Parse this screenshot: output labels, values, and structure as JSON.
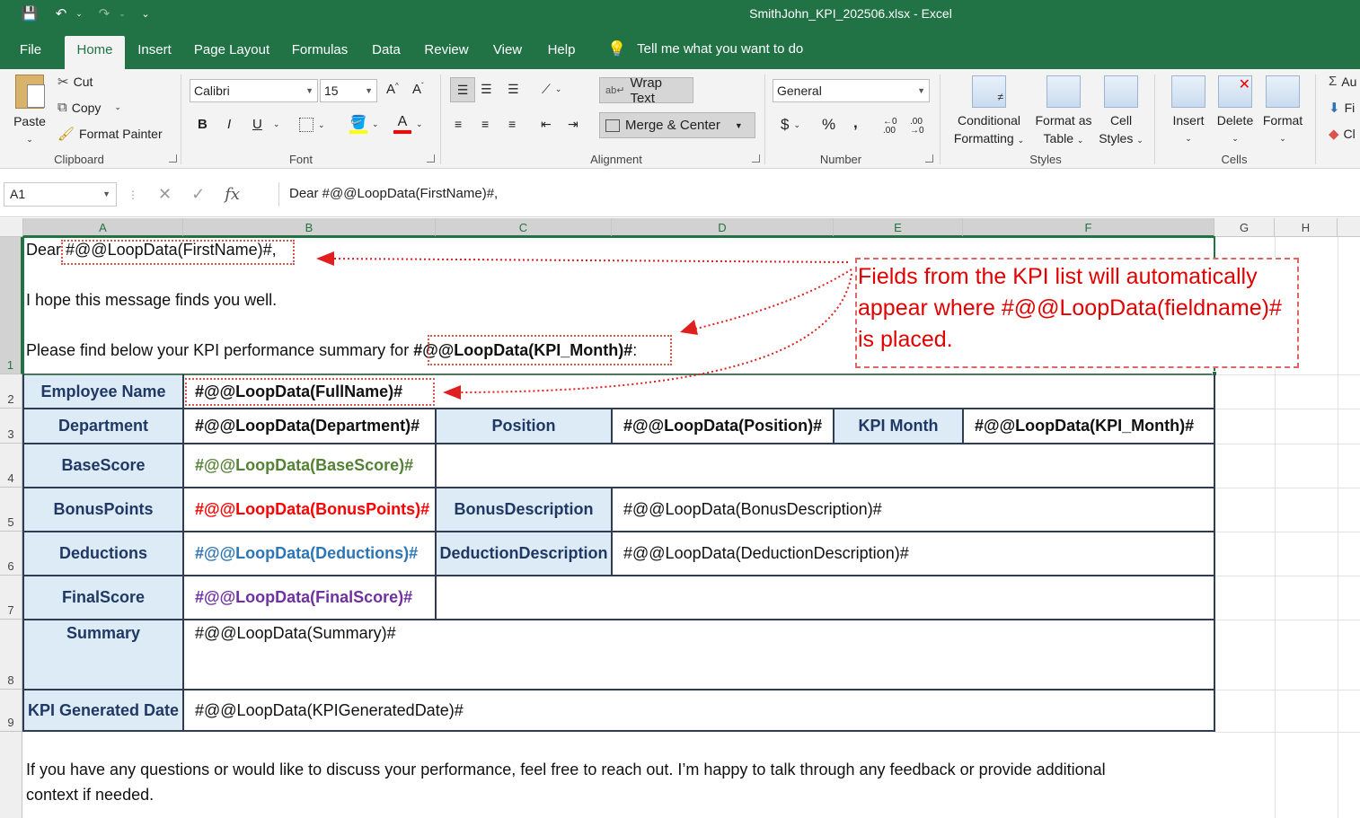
{
  "window": {
    "title": "SmithJohn_KPI_202506.xlsx  -  Excel"
  },
  "quick_access": {
    "save": "💾",
    "undo": "↶",
    "redo": "↷",
    "customize": "⌄"
  },
  "tabs": [
    "File",
    "Home",
    "Insert",
    "Page Layout",
    "Formulas",
    "Data",
    "Review",
    "View",
    "Help"
  ],
  "tell_me": "Tell me what you want to do",
  "ribbon": {
    "clipboard": {
      "paste": "Paste",
      "cut": "Cut",
      "copy": "Copy",
      "format_painter": "Format Painter",
      "label": "Clipboard"
    },
    "font": {
      "name": "Calibri",
      "size": "15",
      "bold": "B",
      "italic": "I",
      "underline": "U",
      "label": "Font"
    },
    "alignment": {
      "wrap_text": "Wrap Text",
      "merge_center": "Merge & Center",
      "label": "Alignment"
    },
    "number": {
      "format": "General",
      "currency": "$",
      "percent": "%",
      "comma": ",",
      "label": "Number"
    },
    "styles": {
      "conditional": "Conditional",
      "conditional2": "Formatting",
      "format_as": "Format as",
      "format_as2": "Table",
      "cell": "Cell",
      "cell2": "Styles",
      "label": "Styles"
    },
    "cells": {
      "insert": "Insert",
      "delete": "Delete",
      "format": "Format",
      "label": "Cells"
    },
    "editing": {
      "autosum": "Au",
      "fill": "Fi",
      "clear": "Cl"
    }
  },
  "formula_bar": {
    "name_box": "A1",
    "cancel": "✕",
    "enter": "✓",
    "fx": "fx",
    "formula": "Dear #@@LoopData(FirstName)#,"
  },
  "columns": [
    "A",
    "B",
    "C",
    "D",
    "E",
    "F",
    "G",
    "H"
  ],
  "rows": [
    "1",
    "2",
    "3",
    "4",
    "5",
    "6",
    "7",
    "8",
    "9"
  ],
  "letter": {
    "greeting_prefix": "Dear ",
    "greeting_field": "#@@LoopData(FirstName)#,",
    "hope": "I hope this message finds you well.",
    "summary_prefix": "Please find below your KPI performance summary for ",
    "summary_field": "#@@LoopData(KPI_Month)#",
    "summary_suffix": ":",
    "closing_line1": "If you have any questions or would like to discuss your performance, feel free to reach out. I’m happy to talk through any feedback or provide additional",
    "closing_line2": "context if needed."
  },
  "table": {
    "employee_name_label": "Employee Name",
    "employee_name_value": "#@@LoopData(FullName)#",
    "department_label": "Department",
    "department_value": "#@@LoopData(Department)#",
    "position_label": "Position",
    "position_value": "#@@LoopData(Position)#",
    "kpi_month_label": "KPI Month",
    "kpi_month_value": "#@@LoopData(KPI_Month)#",
    "basescore_label": "BaseScore",
    "basescore_value": "#@@LoopData(BaseScore)#",
    "bonuspoints_label": "BonusPoints",
    "bonuspoints_value": "#@@LoopData(BonusPoints)#",
    "bonusdesc_label": "BonusDescription",
    "bonusdesc_value": "#@@LoopData(BonusDescription)#",
    "deductions_label": "Deductions",
    "deductions_value": "#@@LoopData(Deductions)#",
    "deductiondesc_label": "DeductionDescription",
    "deductiondesc_value": "#@@LoopData(DeductionDescription)#",
    "finalscore_label": "FinalScore",
    "finalscore_value": "#@@LoopData(FinalScore)#",
    "summary_label": "Summary",
    "summary_value": "#@@LoopData(Summary)#",
    "generated_label": "KPI Generated Date",
    "generated_value": "#@@LoopData(KPIGeneratedDate)#"
  },
  "colors": {
    "excel_green": "#217346",
    "label_fill": "#ddebf7",
    "basescore": "#548235",
    "bonuspoints": "#ff0000",
    "deductions": "#2e75b6",
    "finalscore": "#7030a0",
    "callout": "#e00000"
  },
  "callout": {
    "line1": "Fields from the KPI list will automatically",
    "line2": "appear where #@@LoopData(fieldname)#",
    "line3": "is placed."
  }
}
